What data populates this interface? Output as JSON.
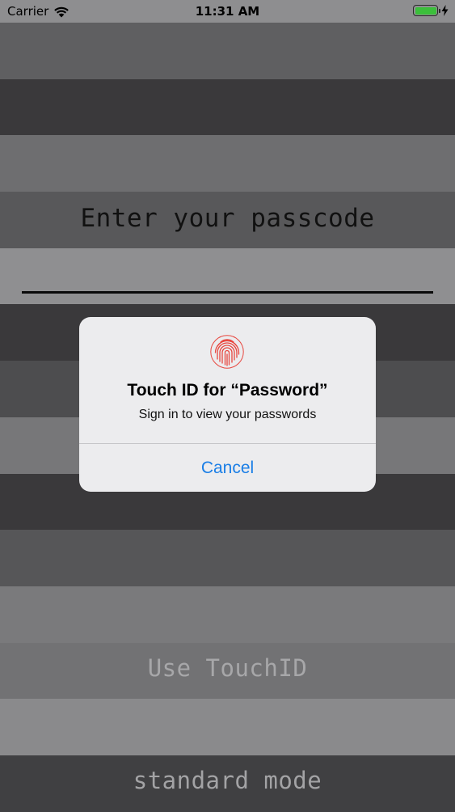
{
  "status_bar": {
    "carrier": "Carrier",
    "time": "11:31 AM",
    "battery_level": 1.0,
    "battery_color": "#3bbf3b",
    "icons": [
      "wifi-icon",
      "battery-icon",
      "charging-bolt-icon"
    ]
  },
  "stripes": [
    "#5f5f61",
    "#3a393b",
    "#6e6e70",
    "#58585a",
    "#8f8f91",
    "#3a393b",
    "#4d4d4f",
    "#777779",
    "#3a393b",
    "#565658",
    "#7a7a7c",
    "#727274",
    "#8a8a8c",
    "#404042"
  ],
  "passcode": {
    "title": "Enter your passcode"
  },
  "alert": {
    "icon": "fingerprint-icon",
    "icon_color": "#e8473f",
    "title": "Touch ID for “Password”",
    "message": "Sign in to view your passwords",
    "cancel_label": "Cancel",
    "accent": "#1a7ee6"
  },
  "buttons": {
    "use_touchid": "Use TouchID",
    "standard_mode": "standard mode"
  }
}
